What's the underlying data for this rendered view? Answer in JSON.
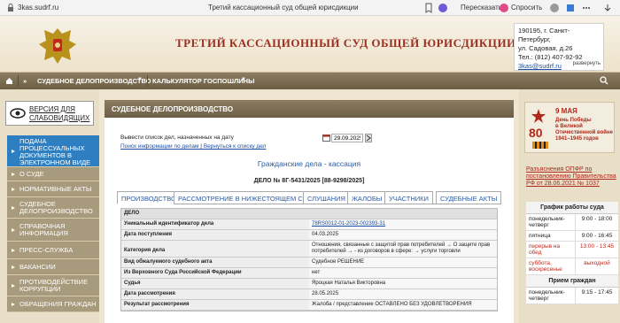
{
  "browser": {
    "url": "3kas.sudrf.ru",
    "tab_title": "Третий кассационный суд общей юрисдикции",
    "translate_label": "Пересказать",
    "ask_label": "Спросить"
  },
  "header": {
    "court_title": "ТРЕТИЙ КАССАЦИОННЫЙ СУД ОБЩЕЙ ЮРИСДИКЦИИ",
    "contact_line1": "190195, г. Санкт-Петербург,",
    "contact_line2": "ул. Садовая, д.26",
    "contact_phone": "Тел.: (812) 407-92-92",
    "contact_email": "3kas@sudrf.ru",
    "expand_label": "развернуть"
  },
  "nav": {
    "items": [
      "СУДЕБНОЕ ДЕЛОПРОИЗВОДСТВО",
      "КАЛЬКУЛЯТОР ГОСПОШЛИНЫ"
    ]
  },
  "sidebar": {
    "vision_label_1": "ВЕРСИЯ ДЛЯ",
    "vision_label_2": "СЛАБОВИДЯЩИХ",
    "menu": [
      {
        "label": "ПОДАЧА ПРОЦЕССУАЛЬНЫХ ДОКУМЕНТОВ В ЭЛЕКТРОННОМ ВИДЕ",
        "active": true
      },
      {
        "label": "О СУДЕ"
      },
      {
        "label": "НОРМАТИВНЫЕ АКТЫ"
      },
      {
        "label": "СУДЕБНОЕ ДЕЛОПРОИЗВОДСТВО"
      },
      {
        "label": "СПРАВОЧНАЯ ИНФОРМАЦИЯ"
      },
      {
        "label": "ПРЕСС-СЛУЖБА"
      },
      {
        "label": "ВАКАНСИИ"
      },
      {
        "label": "ПРОТИВОДЕЙСТВИЕ КОРРУПЦИИ"
      },
      {
        "label": "ОБРАЩЕНИЯ ГРАЖДАН"
      }
    ]
  },
  "main": {
    "header": "СУДЕБНОЕ ДЕЛОПРОИЗВОДСТВО",
    "filter_label": "Вывести список дел, назначенных на дату",
    "filter_date": "29.09.2025",
    "link_search": "Поиск информации по делам",
    "link_sep": " | ",
    "link_back": "Вернуться к списку дел",
    "section_title": "Гражданские дела - кассация",
    "case_number": "ДЕЛО № 8Г-5431/2025 [88-9298/2025]",
    "tabs": [
      "ПРОИЗВОДСТВО",
      "РАССМОТРЕНИЕ В НИЖЕСТОЯЩЕМ СУДЕ",
      "СЛУШАНИЯ",
      "ЖАЛОБЫ",
      "УЧАСТНИКИ",
      "СУДЕБНЫЕ АКТЫ"
    ],
    "table_header": "ДЕЛО",
    "rows": [
      {
        "k": "Уникальный идентификатор дела",
        "v": "78RS0012-01-2023-002393-31",
        "link": true
      },
      {
        "k": "Дата поступления",
        "v": "04.03.2025"
      },
      {
        "k": "Категория дела",
        "v": "Отношения, связанные с защитой прав потребителей → О защите прав потребителей → - из договоров в сфере: → услуги торговли"
      },
      {
        "k": "Вид обжалуемого судебного акта",
        "v": "Судебное РЕШЕНИЕ"
      },
      {
        "k": "Из Верховного Суда Российской Федерации",
        "v": "нет"
      },
      {
        "k": "Судья",
        "v": "Яроцкая Наталья Викторовна"
      },
      {
        "k": "Дата рассмотрения",
        "v": "28.05.2025"
      },
      {
        "k": "Результат рассмотрения",
        "v": "Жалоба / представление ОСТАВЛЕНО БЕЗ УДОВЛЕТВОРЕНИЯ"
      }
    ]
  },
  "right": {
    "banner_line1": "9 МАЯ",
    "banner_line2": "День Победы",
    "banner_line3": "в Великой",
    "banner_line4": "Отечественной войне",
    "banner_line5": "1941–1945 годов",
    "banner_big": "80",
    "opfr_text": "Разъяснения ОПФР по постановлению Правительства РФ от 28.06.2021 № 1037",
    "schedule_title": "График работы суда",
    "schedule": [
      {
        "d": "понедельник-четверг",
        "t": "9:00 - 18:00"
      },
      {
        "d": "пятница",
        "t": "9:00 - 16:45"
      },
      {
        "d": "перерыв на обед",
        "t": "13:00 - 13:45",
        "red": true
      },
      {
        "d": "суббота, воскресенье",
        "t": "выходной",
        "red": true
      }
    ],
    "reception_title": "Прием граждан",
    "reception": [
      {
        "d": "понедельник-четверг",
        "t": "9:15 - 17:45"
      }
    ]
  }
}
